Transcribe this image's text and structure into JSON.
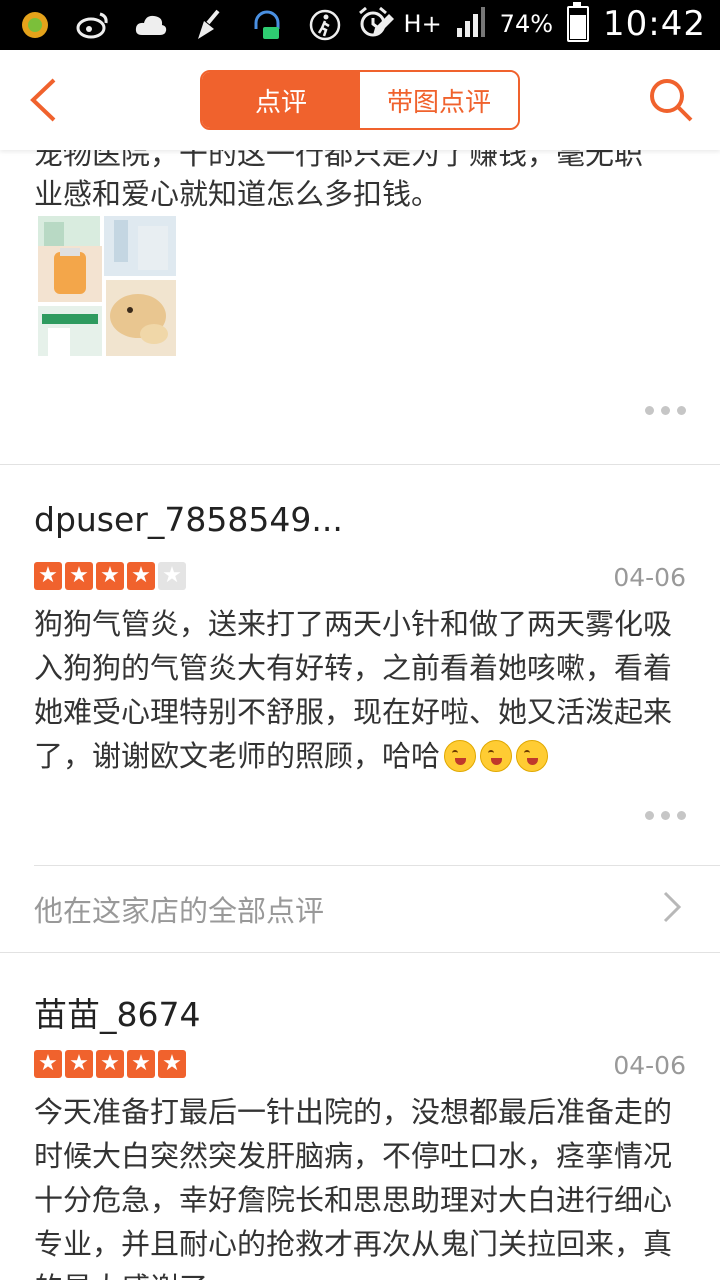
{
  "status_bar": {
    "battery": "74%",
    "network": "H+",
    "time": "10:42",
    "battery_level": 0.74
  },
  "nav": {
    "tab_reviews": "点评",
    "tab_photo_reviews": "带图点评",
    "accent_color": "#f0622d"
  },
  "reviews": [
    {
      "text_partial": "宠物医院，干的这一行都只是为了赚钱，毫无职",
      "text": "业感和爱心就知道怎么多扣钱。"
    },
    {
      "username": "dpuser_7858549...",
      "rating": 4,
      "date": "04-06",
      "text": "狗狗气管炎，送来打了两天小针和做了两天雾化吸入狗狗的气管炎大有好转，之前看着她咳嗽，看着她难受心理特别不舒服，现在好啦、她又活泼起来了，谢谢欧文老师的照顾，哈哈",
      "all_reviews_link": "他在这家店的全部点评"
    },
    {
      "username": "苗苗_8674",
      "rating": 5,
      "date": "04-06",
      "text": "今天准备打最后一针出院的，没想都最后准备走的时候大白突然突发肝脑病，不停吐口水，痉挛情况十分危急，幸好詹院长和思思助理对大白进行细心专业，并且耐心的抢救才再次从鬼门关拉回来，真的是太感谢了"
    }
  ]
}
